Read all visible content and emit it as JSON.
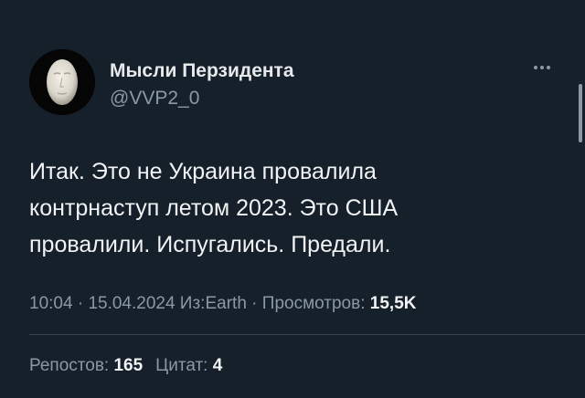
{
  "author": {
    "display_name": "Мысли Перзидента",
    "handle": "@VVP2_0"
  },
  "tweet": {
    "lines": [
      "Итак. Это не Украина провалила",
      "контрнаступ летом 2023. Это США",
      "провалили. Испугались. Предали."
    ]
  },
  "meta": {
    "time": "10:04",
    "sep1": " · ",
    "date": "15.04.2024",
    "source_prefix": " Из:",
    "source": "Earth",
    "sep2": " · ",
    "views_label": "Просмотров: ",
    "views_value": "15,5K"
  },
  "stats": {
    "reposts_label": "Репостов: ",
    "reposts_value": "165",
    "quotes_label": "Цитат: ",
    "quotes_value": "4"
  },
  "icons": {
    "more": "more-horizontal-icon"
  },
  "colors": {
    "background": "#15202b",
    "text": "#e7e9ea",
    "secondary": "#8b98a5",
    "divider": "#38444d"
  }
}
